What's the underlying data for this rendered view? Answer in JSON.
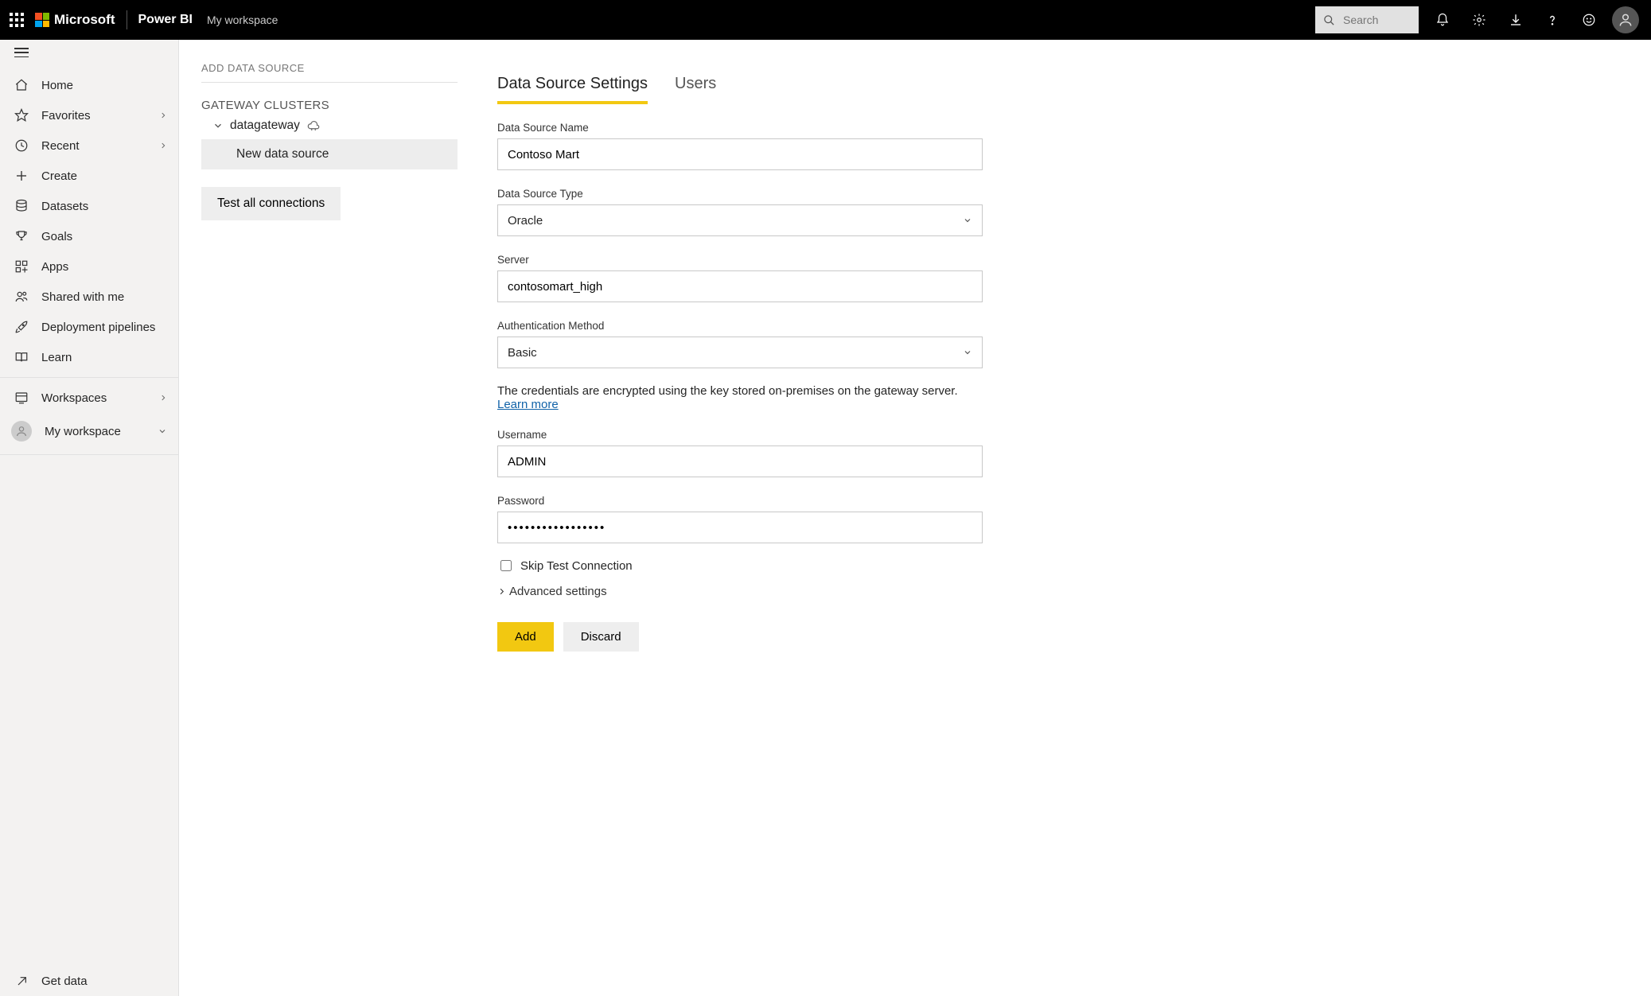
{
  "header": {
    "company": "Microsoft",
    "product": "Power BI",
    "breadcrumb": "My workspace",
    "search_placeholder": "Search"
  },
  "nav": {
    "items": [
      {
        "icon": "home",
        "label": "Home",
        "chevron": false
      },
      {
        "icon": "star",
        "label": "Favorites",
        "chevron": true
      },
      {
        "icon": "clock",
        "label": "Recent",
        "chevron": true
      },
      {
        "icon": "plus",
        "label": "Create",
        "chevron": false
      },
      {
        "icon": "db",
        "label": "Datasets",
        "chevron": false
      },
      {
        "icon": "trophy",
        "label": "Goals",
        "chevron": false
      },
      {
        "icon": "apps",
        "label": "Apps",
        "chevron": false
      },
      {
        "icon": "shared",
        "label": "Shared with me",
        "chevron": false
      },
      {
        "icon": "rocket",
        "label": "Deployment pipelines",
        "chevron": false
      },
      {
        "icon": "book",
        "label": "Learn",
        "chevron": false
      }
    ],
    "workspaces_label": "Workspaces",
    "myworkspace_label": "My workspace",
    "getdata_label": "Get data"
  },
  "clusters": {
    "page_title": "ADD DATA SOURCE",
    "section_title": "GATEWAY CLUSTERS",
    "gateway_name": "datagateway",
    "new_source_label": "New data source",
    "test_button": "Test all connections"
  },
  "tabs": {
    "settings": "Data Source Settings",
    "users": "Users"
  },
  "form": {
    "ds_name_label": "Data Source Name",
    "ds_name_value": "Contoso Mart",
    "ds_type_label": "Data Source Type",
    "ds_type_value": "Oracle",
    "server_label": "Server",
    "server_value": "contosomart_high",
    "auth_label": "Authentication Method",
    "auth_value": "Basic",
    "info_text": "The credentials are encrypted using the key stored on-premises on the gateway server. ",
    "info_link": "Learn more",
    "username_label": "Username",
    "username_value": "ADMIN",
    "password_label": "Password",
    "password_value": "•••••••••••••••••",
    "skip_test_label": "Skip Test Connection",
    "advanced_label": "Advanced settings",
    "add_btn": "Add",
    "discard_btn": "Discard"
  }
}
